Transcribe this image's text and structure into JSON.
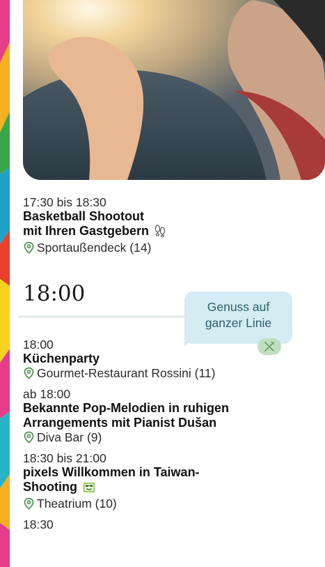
{
  "events_top": [
    {
      "time": "17:30 bis 18:30",
      "title_line1": "Basketball Shootout",
      "title_line2": "mit Ihren Gastgebern",
      "icon": "footprints-icon",
      "location": "Sportaußendeck (14)"
    }
  ],
  "hour_heading": "18:00",
  "tip_bubble": {
    "line1": "Genuss auf",
    "line2": "ganzer Linie",
    "icon": "fork-knife-icon"
  },
  "events": [
    {
      "time": "18:00",
      "title": "Küchenparty",
      "location": "Gourmet-Restaurant Rossini (11)"
    },
    {
      "time": "ab 18:00",
      "title_line1": "Bekannte Pop-Melodien in ruhigen",
      "title_line2": "Arrangements mit Pianist Dušan",
      "location": "Diva Bar (9)"
    },
    {
      "time": "18:30 bis 21:00",
      "title_line1": "pixels Willkommen in Taiwan-",
      "title_line2": "Shooting",
      "icon": "camera-smiley-icon",
      "location": "Theatrium (10)"
    },
    {
      "time": "18:30"
    }
  ],
  "colors": {
    "bubble_bg": "#d4ecf2",
    "bubble_text": "#2e5f6d",
    "pin_green": "#3f8a3f",
    "accent_green": "#7bc043"
  }
}
